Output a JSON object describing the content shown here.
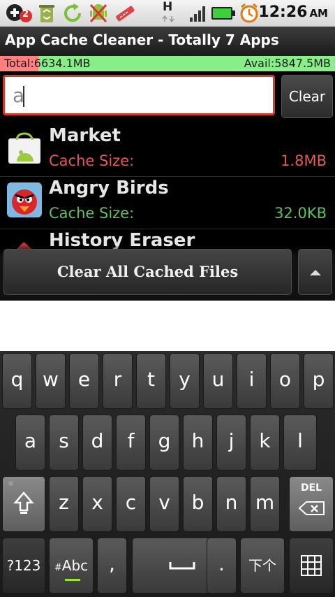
{
  "status_bar": {
    "time": "12:26",
    "ampm": "AM",
    "notification_badge": "2",
    "network_label": "H",
    "icons": [
      "add-badge-icon",
      "recycle-bin-icon",
      "refresh-icon",
      "android-bug-icon",
      "ruler-tool-icon",
      "network-h-icon",
      "signal-icon",
      "battery-icon",
      "alarm-clock-icon"
    ]
  },
  "app_bar": {
    "title": "App Cache Cleaner - Totally 7 Apps"
  },
  "storage": {
    "total_label": "Total:",
    "total_value": "6634.1MB",
    "avail_label": "Avail:",
    "avail_value": "5847.5MB",
    "used_fraction": 0.115
  },
  "search": {
    "value": "a",
    "clear_label": "Clear"
  },
  "apps": [
    {
      "name": "Market",
      "cache_label": "Cache Size:",
      "cache_value": "1.8MB",
      "color": "#e05a5a",
      "icon": "market-bag-icon"
    },
    {
      "name": "Angry Birds",
      "cache_label": "Cache Size:",
      "cache_value": "32.0KB",
      "color": "#5cc35c",
      "icon": "angry-bird-icon"
    },
    {
      "name": "History Eraser",
      "icon": "history-eraser-icon"
    }
  ],
  "actions": {
    "clear_all_label": "Clear All Cached Files",
    "up_icon": "triangle-up-icon"
  },
  "keyboard": {
    "row1": [
      "q",
      "w",
      "e",
      "r",
      "t",
      "y",
      "u",
      "i",
      "o",
      "p"
    ],
    "row2": [
      "a",
      "s",
      "d",
      "f",
      "g",
      "h",
      "j",
      "k",
      "l"
    ],
    "row3": [
      "z",
      "x",
      "c",
      "v",
      "b",
      "n",
      "m"
    ],
    "shift_icon": "shift-arrow-icon",
    "del_label": "DEL",
    "del_icon": "backspace-icon",
    "sym_label": "?123",
    "abc_prefix": "#",
    "abc_label": "Abc",
    "comma": ",",
    "space_icon": "space-bar-icon",
    "period": ".",
    "lang_label": "下个",
    "grid_icon": "keypad-grid-icon"
  }
}
